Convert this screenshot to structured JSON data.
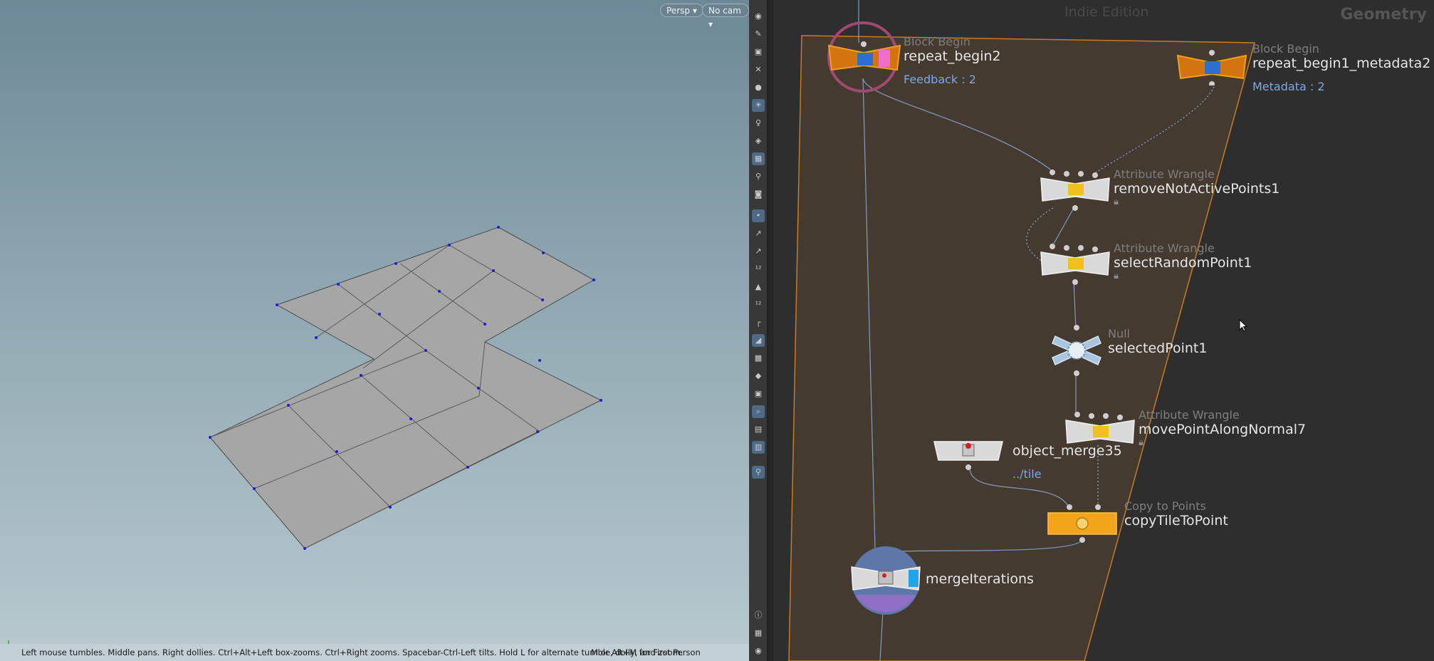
{
  "viewport": {
    "view_label": "Persp",
    "cam_label": "No cam",
    "status_text": "Left mouse tumbles. Middle pans. Right dollies. Ctrl+Alt+Left box-zooms. Ctrl+Right zooms. Spacebar-Ctrl-Left tilts. Hold L for alternate tumble, dolly, and zoom.",
    "status_text2": "M or Alt+M for First Person Navigation."
  },
  "toolbar": {
    "icons": [
      "eye-icon",
      "brush-icon",
      "lock-icon",
      "x-ray-icon",
      "sphere-icon",
      "light-icon",
      "bulb-icon",
      "camera-light-icon",
      "skull-icon",
      "checker-icon",
      "measure-icon",
      "camera-icon",
      "point-display-icon",
      "normal-icon",
      "vector-icon",
      "point-number-icon",
      "brush2-icon",
      "stamp-icon",
      "corner-icon",
      "selection-icon",
      "grid-icon",
      "shading-icon",
      "texture-icon",
      "snap-icon",
      "display-icon",
      "ghost-icon",
      "pin-icon",
      "info-icon",
      "layout-icon",
      "visibility-icon"
    ]
  },
  "network": {
    "edition": "Indie Edition",
    "context": "Geometry",
    "nodes": [
      {
        "type": "Block Begin",
        "name": "repeat_begin2",
        "extra": "Feedback : 2"
      },
      {
        "type": "Block Begin",
        "name": "repeat_begin1_metadata2",
        "extra": "Metadata : 2"
      },
      {
        "type": "Attribute Wrangle",
        "name": "removeNotActivePoints1"
      },
      {
        "type": "Attribute Wrangle",
        "name": "selectRandomPoint1"
      },
      {
        "type": "Null",
        "name": "selectedPoint1"
      },
      {
        "type": "Attribute Wrangle",
        "name": "movePointAlongNormal7"
      },
      {
        "type": "",
        "name": "object_merge35",
        "extra": "../tile"
      },
      {
        "type": "Copy to Points",
        "name": "copyTileToPoint"
      },
      {
        "type": "",
        "name": "mergeIterations"
      }
    ]
  },
  "colors": {
    "accent_orange": "#f0a020",
    "block_orange": "#d3740f",
    "link_blue": "#7aa9e6",
    "viewport_top": "#6d8896",
    "viewport_bottom": "#b9c9cf"
  }
}
